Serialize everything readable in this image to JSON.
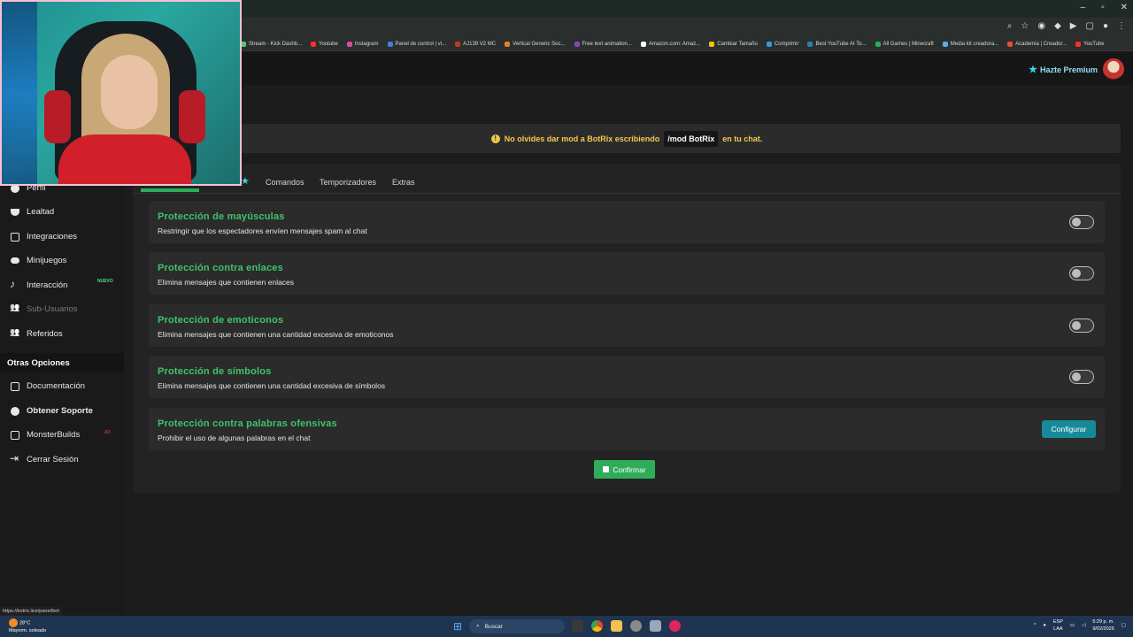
{
  "browser": {
    "bookmarks": [
      "Stream - Kick Dashb...",
      "Youtube",
      "Instagram",
      "Panel de control | vi...",
      "AJ139 V2 MC",
      "Vertical Generic Soc...",
      "Free text animation...",
      "Amazon.com: Amaz...",
      "Cambiar Tamaño",
      "Comprimir",
      "Best YouTube AI To...",
      "All Games | Minecraft",
      "Media kit creadora...",
      "Academia | Creador...",
      "YouTube"
    ],
    "bookmark_colors": [
      "#4bd07a",
      "#ff2d2d",
      "#d94b9e",
      "#4b7bd9",
      "#c0392b",
      "#e67e22",
      "#8e44ad",
      "#ffffff",
      "#f1c40f",
      "#3498db",
      "#2980b9",
      "#27ae60",
      "#5dade2",
      "#e74c3c",
      "#ff2d2d"
    ]
  },
  "header": {
    "premium_label": "Hazte Premium"
  },
  "notice": {
    "text_before": "No olvides dar mod a BotRix escribiendo",
    "command": "/mod BotRix",
    "text_after": "en tu chat."
  },
  "sidebar": {
    "items": [
      {
        "label": "Perfil",
        "icon": "user-icon"
      },
      {
        "label": "Lealtad",
        "icon": "trophy-icon"
      },
      {
        "label": "Integraciones",
        "icon": "integration-icon"
      },
      {
        "label": "Minijuegos",
        "icon": "gamepad-icon"
      },
      {
        "label": "Interacción",
        "icon": "music-icon",
        "badge": "NUEVO"
      },
      {
        "label": "Sub-Usuarios",
        "icon": "users-icon",
        "disabled": true
      },
      {
        "label": "Referidos",
        "icon": "users-icon"
      }
    ],
    "other_heading": "Otras Opciones",
    "other_items": [
      {
        "label": "Documentación",
        "icon": "document-icon"
      },
      {
        "label": "Obtener Soporte",
        "icon": "help-icon"
      },
      {
        "label": "MonsterBuilds",
        "icon": "monitor-icon",
        "badge": "AD"
      },
      {
        "label": "Cerrar Sesión",
        "icon": "logout-icon"
      }
    ]
  },
  "tabs": [
    "Comandos",
    "Temporizadores",
    "Extras"
  ],
  "protections": [
    {
      "title": "Protección de mayúsculas",
      "desc": "Restringir que los espectadores envíen mensajes spam al chat",
      "control": "toggle",
      "enabled": false
    },
    {
      "title": "Protección contra enlaces",
      "desc": "Elimina mensajes que contienen enlaces",
      "control": "toggle",
      "enabled": false
    },
    {
      "title": "Protección de emoticonos",
      "desc": "Elimina mensajes que contienen una cantidad excesiva de emoticonos",
      "control": "toggle",
      "enabled": false
    },
    {
      "title": "Protección de símbolos",
      "desc": "Elimina mensajes que contienen una cantidad excesiva de símbolos",
      "control": "toggle",
      "enabled": false
    },
    {
      "title": "Protección contra palabras ofensivas",
      "desc": "Prohibir el uso de algunas palabras en el chat",
      "control": "button",
      "button_label": "Configurar"
    }
  ],
  "confirm_label": "Confirmar",
  "status_url": "https://botrix.live/panel/bot",
  "taskbar": {
    "weather_temp": "28°C",
    "weather_desc": "Mayorm. soleado",
    "search_placeholder": "Buscar",
    "lang_top": "ESP",
    "lang_bottom": "LAA",
    "time": "5:29 p. m.",
    "date": "9/02/2026"
  },
  "colors": {
    "accent_green": "#2eac5a",
    "title_green": "#3fc46a",
    "notice_yellow": "#f2c94c",
    "config_teal": "#178a9a",
    "premium_cyan": "#3fd2e8"
  }
}
